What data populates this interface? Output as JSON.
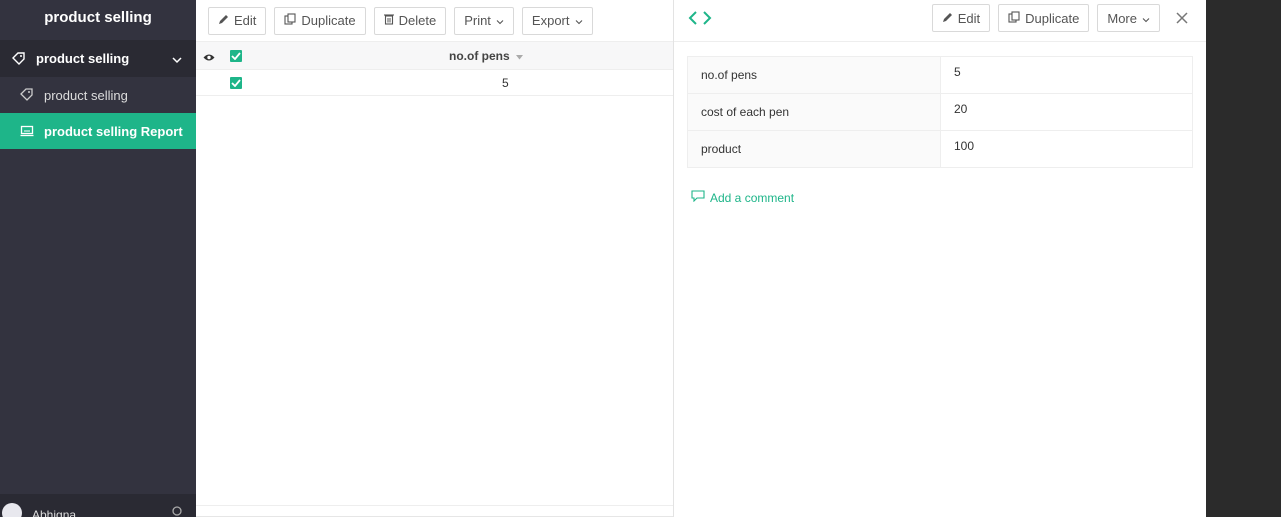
{
  "sidebar": {
    "app_title": "product selling",
    "group_label": "product selling",
    "items": [
      {
        "label": "product selling"
      },
      {
        "label": "product selling Report"
      }
    ],
    "user_name": "Abhigna"
  },
  "toolbar": {
    "edit_label": "Edit",
    "duplicate_label": "Duplicate",
    "delete_label": "Delete",
    "print_label": "Print",
    "export_label": "Export"
  },
  "list": {
    "column_header": "no.of pens",
    "rows": [
      {
        "no_of_pens": "5"
      }
    ]
  },
  "panel": {
    "edit_label": "Edit",
    "duplicate_label": "Duplicate",
    "more_label": "More",
    "fields": [
      {
        "label": "no.of pens",
        "value": "5"
      },
      {
        "label": "cost of each pen",
        "value": "20"
      },
      {
        "label": "product",
        "value": "100"
      }
    ],
    "comment_label": "Add a comment"
  },
  "colors": {
    "accent": "#1eb589",
    "sidebar_bg": "#33333f"
  }
}
